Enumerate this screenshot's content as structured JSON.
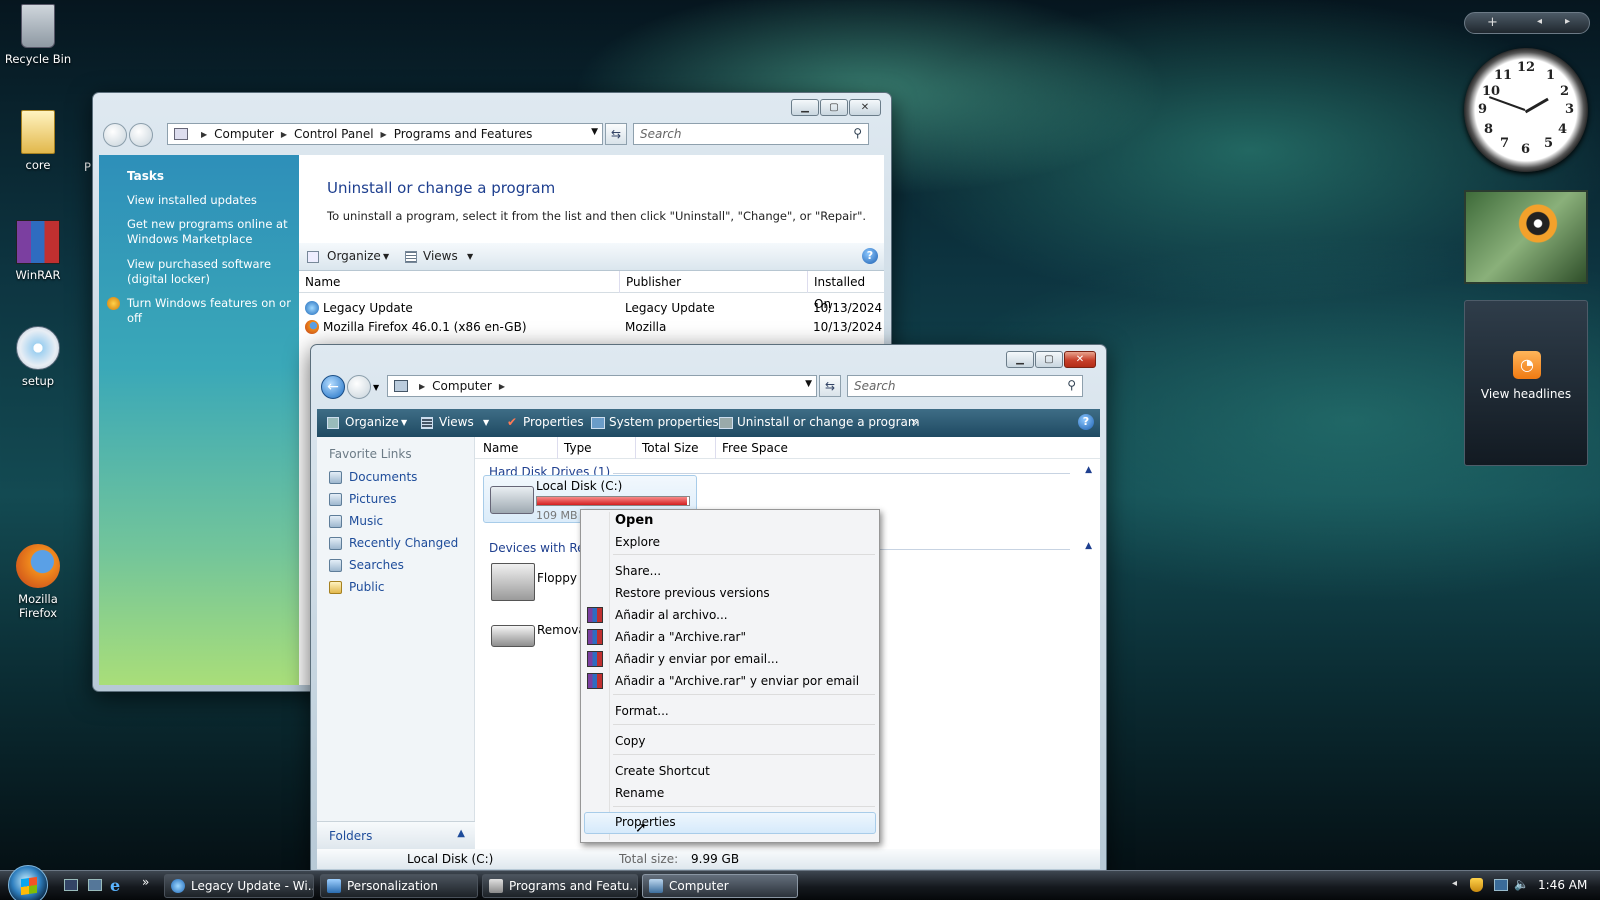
{
  "desktop": {
    "icons": [
      {
        "label": "Recycle Bin",
        "icon": "recycle-bin-icon"
      },
      {
        "label": "core",
        "icon": "folder-icon"
      },
      {
        "label": "WinRAR",
        "icon": "winrar-icon"
      },
      {
        "label": "setup",
        "icon": "cd-setup-icon"
      },
      {
        "label": "Mozilla Firefox",
        "icon": "firefox-icon"
      }
    ]
  },
  "programs_window": {
    "breadcrumb": [
      "Computer",
      "Control Panel",
      "Programs and Features"
    ],
    "search_placeholder": "Search",
    "tasks_title": "Tasks",
    "tasks": [
      "View installed updates",
      "Get new programs online at Windows Marketplace",
      "View purchased software (digital locker)",
      "Turn Windows features on or off"
    ],
    "heading": "Uninstall or change a program",
    "description": "To uninstall a program, select it from the list and then click \"Uninstall\", \"Change\", or \"Repair\".",
    "toolbar": {
      "organize": "Organize",
      "views": "Views"
    },
    "columns": [
      "Name",
      "Publisher",
      "Installed On"
    ],
    "rows": [
      {
        "name": "Legacy Update",
        "publisher": "Legacy Update",
        "installed": "10/13/2024"
      },
      {
        "name": "Mozilla Firefox 46.0.1 (x86 en-GB)",
        "publisher": "Mozilla",
        "installed": "10/13/2024"
      }
    ]
  },
  "computer_window": {
    "breadcrumb": [
      "Computer"
    ],
    "search_placeholder": "Search",
    "toolbar": {
      "organize": "Organize",
      "views": "Views",
      "properties": "Properties",
      "system_properties": "System properties",
      "uninstall": "Uninstall or change a program",
      "more": "»"
    },
    "favorite_links_title": "Favorite Links",
    "favorite_links": [
      "Documents",
      "Pictures",
      "Music",
      "Recently Changed",
      "Searches",
      "Public"
    ],
    "folders_label": "Folders",
    "columns": [
      "Name",
      "Type",
      "Total Size",
      "Free Space"
    ],
    "groups": {
      "hdd": "Hard Disk Drives (1)",
      "removable": "Devices with Rem"
    },
    "drives": {
      "local_disk": "Local Disk (C:)",
      "local_disk_free": "109 MB",
      "floppy": "Floppy D",
      "removable": "Remova"
    },
    "status": {
      "name": "Local Disk (C:)",
      "total_label": "Total size:",
      "total_value": "9.99 GB"
    },
    "disk_usage_fraction": 0.99
  },
  "context_menu": {
    "items": [
      "Open",
      "Explore",
      "Share...",
      "Restore previous versions",
      "Añadir al archivo...",
      "Añadir a \"Archive.rar\"",
      "Añadir y enviar por email...",
      "Añadir a \"Archive.rar\" y enviar por email",
      "Format...",
      "Copy",
      "Create Shortcut",
      "Rename",
      "Properties"
    ]
  },
  "gadgets": {
    "headlines": "View headlines",
    "clock_numbers": [
      "12",
      "1",
      "2",
      "3",
      "4",
      "5",
      "6",
      "7",
      "8",
      "9",
      "10",
      "11"
    ]
  },
  "taskbar": {
    "buttons": [
      "Legacy Update - Wi...",
      "Personalization",
      "Programs and Featu...",
      "Computer"
    ],
    "time": "1:46 AM",
    "more": "»"
  }
}
